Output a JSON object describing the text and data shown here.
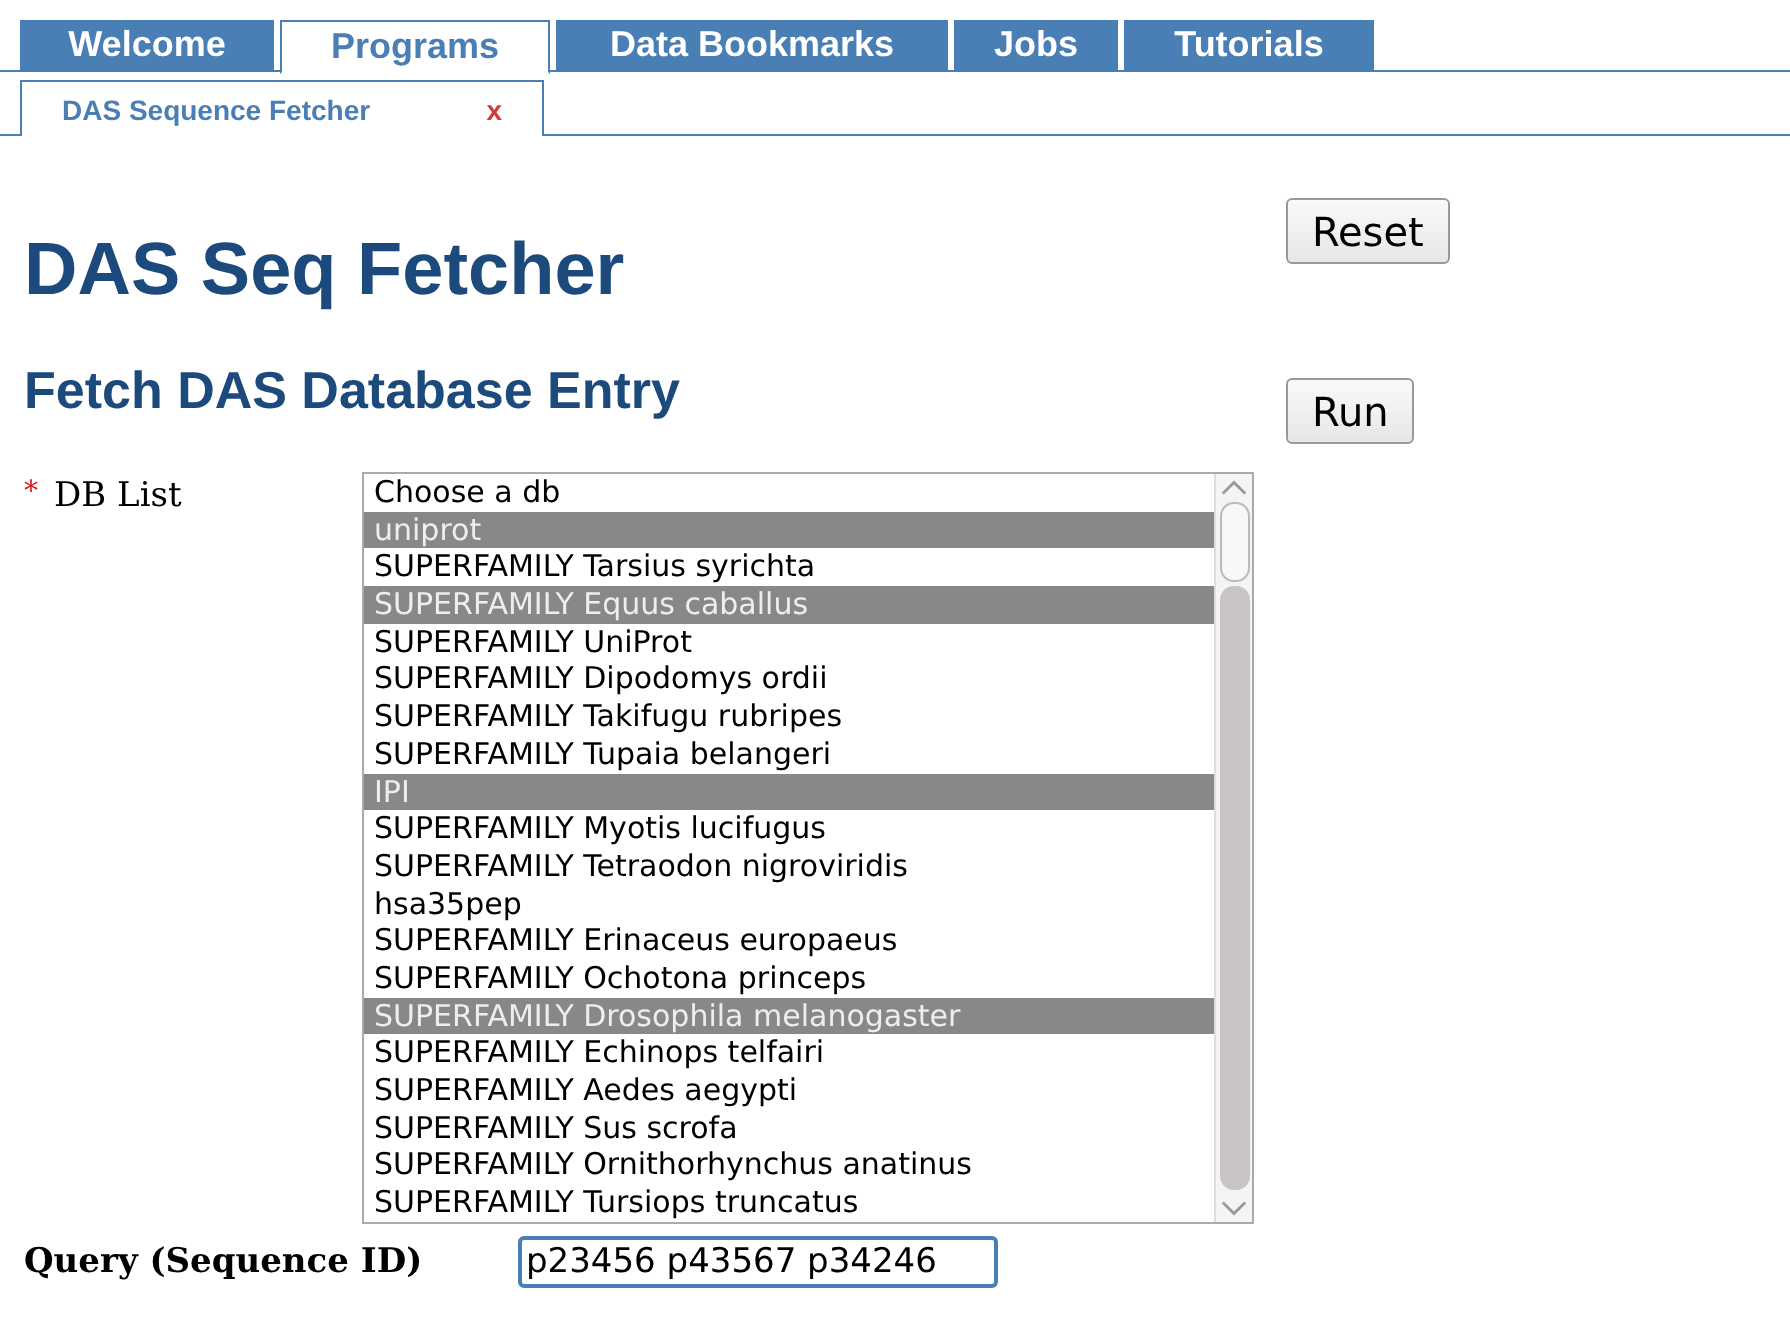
{
  "tabs": [
    {
      "label": "Welcome",
      "selected": false
    },
    {
      "label": "Programs",
      "selected": true
    },
    {
      "label": "Data Bookmarks",
      "selected": false
    },
    {
      "label": "Jobs",
      "selected": false
    },
    {
      "label": "Tutorials",
      "selected": false
    }
  ],
  "subtabs": [
    {
      "label": "DAS Sequence Fetcher",
      "close": "x",
      "selected": true
    }
  ],
  "title": "DAS Seq Fetcher",
  "subtitle": "Fetch DAS Database Entry",
  "buttons": [
    {
      "label": "Reset"
    },
    {
      "label": "Run"
    }
  ],
  "db_list": {
    "label": "DB List",
    "required_mark": "*",
    "items": [
      {
        "label": "Choose a db",
        "selected": false
      },
      {
        "label": "uniprot",
        "selected": true
      },
      {
        "label": "SUPERFAMILY Tarsius syrichta",
        "selected": false
      },
      {
        "label": "SUPERFAMILY Equus caballus",
        "selected": true
      },
      {
        "label": "SUPERFAMILY UniProt",
        "selected": false
      },
      {
        "label": "SUPERFAMILY Dipodomys ordii",
        "selected": false
      },
      {
        "label": "SUPERFAMILY Takifugu rubripes",
        "selected": false
      },
      {
        "label": "SUPERFAMILY Tupaia belangeri",
        "selected": false
      },
      {
        "label": "IPI",
        "selected": true
      },
      {
        "label": "SUPERFAMILY Myotis lucifugus",
        "selected": false
      },
      {
        "label": "SUPERFAMILY Tetraodon nigroviridis",
        "selected": false
      },
      {
        "label": "hsa35pep",
        "selected": false
      },
      {
        "label": "SUPERFAMILY Erinaceus europaeus",
        "selected": false
      },
      {
        "label": "SUPERFAMILY Ochotona princeps",
        "selected": false
      },
      {
        "label": "SUPERFAMILY Drosophila melanogaster",
        "selected": true
      },
      {
        "label": "SUPERFAMILY Echinops telfairi",
        "selected": false
      },
      {
        "label": "SUPERFAMILY Aedes aegypti",
        "selected": false
      },
      {
        "label": "SUPERFAMILY Sus scrofa",
        "selected": false
      },
      {
        "label": "SUPERFAMILY Ornithorhynchus anatinus",
        "selected": false
      },
      {
        "label": "SUPERFAMILY Tursiops truncatus",
        "selected": false
      }
    ]
  },
  "query": {
    "label": "Query (Sequence ID)",
    "value": "p23456 p43567 p34246"
  }
}
